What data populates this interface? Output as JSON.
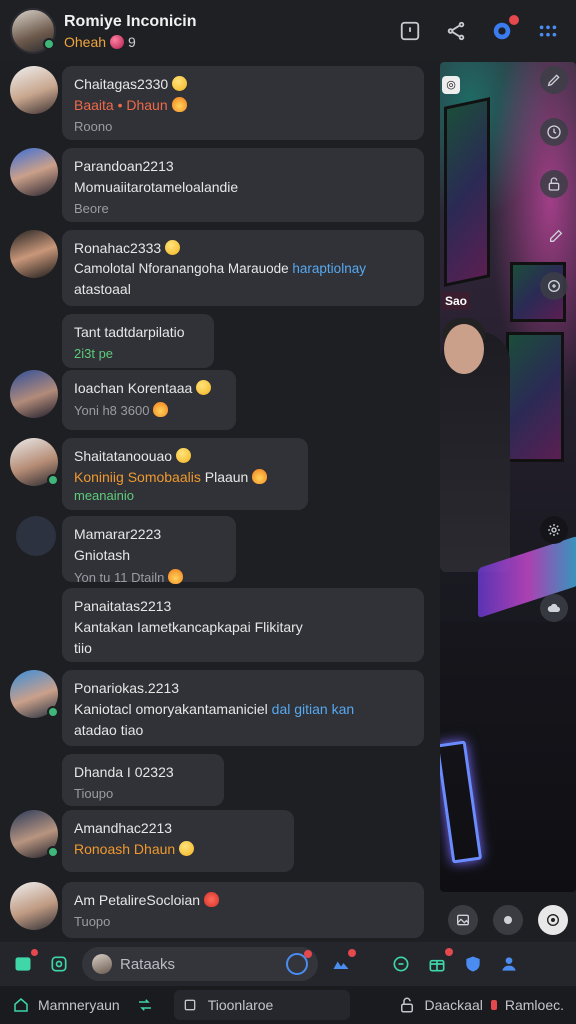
{
  "header": {
    "title": "Romiye Inconicin",
    "status": "Oheah",
    "status_count": "9",
    "accent": "#f0a43c"
  },
  "messages": [
    {
      "name": "Chaitagas2330",
      "line1": "Baaita • Dhaun",
      "sub": "Roono"
    },
    {
      "name": "Parandoan2213",
      "line1": "Momuaiitarotameloalandie",
      "sub": "Beore"
    },
    {
      "name": "Ronahac2333",
      "line1": "Camolotal Nforanangoha Marauode",
      "line1_link": "haraptiolnay",
      "line2": "atastoaal"
    },
    {
      "name": "Tant tadtdarpilatio",
      "sub": "2i3t pe"
    },
    {
      "name": "Ioachan Korentaaa",
      "sub": "Yoni h8 3600"
    },
    {
      "name": "Shaitatanoouao",
      "line1": "Koniniig Somobaalis",
      "line1_rest": "Plaaun",
      "sub": "meanainio"
    },
    {
      "name": "Mamarar2223",
      "line1": "Gniotash",
      "sub": "Yon tu 11 Dtailn"
    },
    {
      "name": "Panaitatas2213",
      "line1": "Kantakan Iametkancapkapai Flikitary",
      "line2": "tiio"
    },
    {
      "name": "Ponariokas.2213",
      "line1": "Kaniotacl omoryakantamaniciel",
      "line1_link": "dal gitian kan",
      "line2": "atadao tiao"
    },
    {
      "name": "Dhanda I 02323",
      "sub": "Tioupo"
    },
    {
      "name": "Amandhac2213",
      "line1": "Ronoash Dhaun"
    },
    {
      "name": "Am PetalireSocloian",
      "sub": "Tuopo"
    }
  ],
  "video": {
    "label": "Sao"
  },
  "input": {
    "placeholder": "Rataaks"
  },
  "bottom_nav": {
    "left": "Mamneryaun",
    "middle": "Tioonlaroe",
    "right": "Daackaal",
    "right_rest": "Ramloec."
  },
  "colors": {
    "bubble": "#303237",
    "background": "#1e1f23",
    "green": "#5ecb7a",
    "orange": "#f0992f",
    "link": "#58a8f0",
    "badge": "#e5484d"
  }
}
